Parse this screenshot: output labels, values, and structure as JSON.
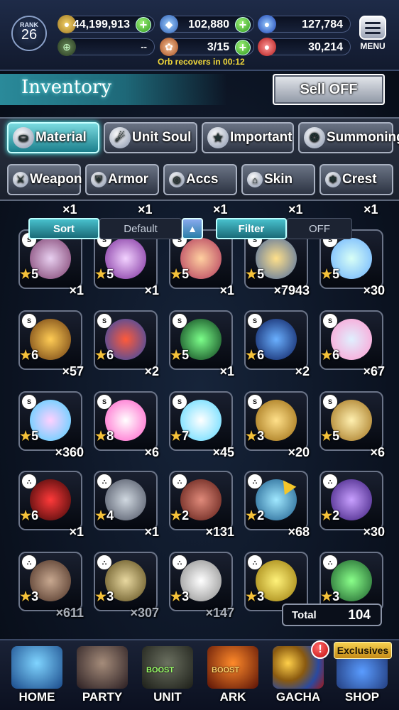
{
  "status": {
    "rank_label": "RANK",
    "rank_value": "26",
    "gil": "44,199,913",
    "lapis": "102,880",
    "blue_crystals": "127,784",
    "stamina_left": "--",
    "orbs": "3/15",
    "red_crystals": "30,214",
    "orb_recover_text": "Orb recovers in 00:12",
    "menu_label": "MENU"
  },
  "header": {
    "title": "Inventory",
    "sell_off_label": "Sell OFF"
  },
  "tabs_row1": [
    {
      "label": "Material",
      "icon": "bag-icon",
      "active": true
    },
    {
      "label": "Unit Soul",
      "icon": "flame-icon",
      "active": false
    },
    {
      "label": "Important",
      "icon": "star-icon",
      "active": false
    },
    {
      "label": "Summoning",
      "icon": "swirl-icon",
      "active": false
    }
  ],
  "tabs_row2": [
    {
      "label": "Weapon",
      "icon": "sword-icon"
    },
    {
      "label": "Armor",
      "icon": "armor-icon"
    },
    {
      "label": "Accs",
      "icon": "ring-icon"
    },
    {
      "label": "Skin",
      "icon": "hanger-icon"
    },
    {
      "label": "Crest",
      "icon": "crest-icon"
    }
  ],
  "sortbar": {
    "sort_label": "Sort",
    "sort_value": "Default",
    "arrow": "▲",
    "filter_label": "Filter",
    "filter_value": "OFF"
  },
  "partial_row_qty": [
    "×1",
    "×1",
    "×1",
    "×1",
    "×1"
  ],
  "items": [
    {
      "stars": "5",
      "qty": "×1"
    },
    {
      "stars": "5",
      "qty": "×1"
    },
    {
      "stars": "5",
      "qty": "×1"
    },
    {
      "stars": "5",
      "qty": "×7943"
    },
    {
      "stars": "5",
      "qty": "×30"
    },
    {
      "stars": "6",
      "qty": "×57"
    },
    {
      "stars": "6",
      "qty": "×2"
    },
    {
      "stars": "5",
      "qty": "×1"
    },
    {
      "stars": "6",
      "qty": "×2"
    },
    {
      "stars": "6",
      "qty": "×67"
    },
    {
      "stars": "5",
      "qty": "×360"
    },
    {
      "stars": "8",
      "qty": "×6"
    },
    {
      "stars": "7",
      "qty": "×45"
    },
    {
      "stars": "3",
      "qty": "×20"
    },
    {
      "stars": "5",
      "qty": "×6"
    },
    {
      "stars": "6",
      "qty": "×1"
    },
    {
      "stars": "4",
      "qty": "×1"
    },
    {
      "stars": "2",
      "qty": "×131"
    },
    {
      "stars": "2",
      "qty": "×68"
    },
    {
      "stars": "2",
      "qty": "×30"
    },
    {
      "stars": "3",
      "qty": "×611"
    },
    {
      "stars": "3",
      "qty": "×307"
    },
    {
      "stars": "3",
      "qty": "×147"
    },
    {
      "stars": "3",
      "qty": ""
    },
    {
      "stars": "3",
      "qty": ""
    }
  ],
  "total": {
    "label": "Total",
    "value": "104"
  },
  "bottom_nav": [
    {
      "label": "HOME"
    },
    {
      "label": "PARTY"
    },
    {
      "label": "UNIT",
      "boost": "BOOST"
    },
    {
      "label": "ARK",
      "boost": "BOOST"
    },
    {
      "label": "GACHA"
    },
    {
      "label": "SHOP"
    }
  ],
  "exclusives_label": "Exclusives",
  "alert_glyph": "!",
  "colors": {
    "accent_teal": "#3fb4c2",
    "star_gold": "#f5c23a",
    "plus_green": "#2f9a1c",
    "orb_text": "#f2d93a"
  }
}
